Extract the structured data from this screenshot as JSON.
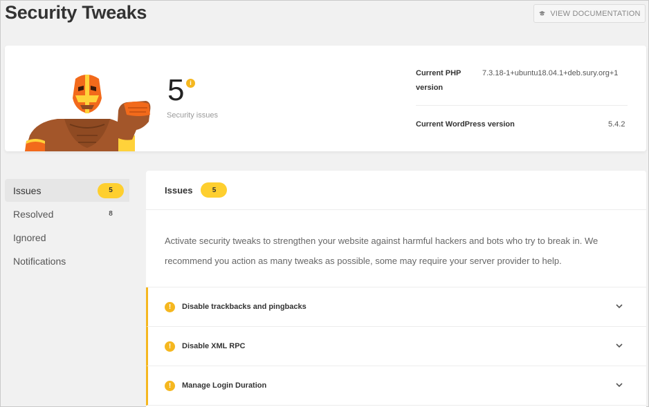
{
  "header": {
    "title": "Security Tweaks",
    "doc_button_label": "VIEW DOCUMENTATION"
  },
  "summary": {
    "issue_count": "5",
    "issue_caption": "Security issues",
    "info_icon": "i",
    "php_label": "Current PHP version",
    "php_value": "7.3.18-1+ubuntu18.04.1+deb.sury.org+1",
    "wp_label": "Current WordPress version",
    "wp_value": "5.4.2"
  },
  "sidebar": {
    "items": [
      {
        "label": "Issues",
        "count": "5"
      },
      {
        "label": "Resolved",
        "count": "8"
      },
      {
        "label": "Ignored",
        "count": ""
      },
      {
        "label": "Notifications",
        "count": ""
      }
    ]
  },
  "main": {
    "title": "Issues",
    "count": "5",
    "intro": "Activate security tweaks to strengthen your website against harmful hackers and bots who try to break in. We recommend you action as many tweaks as possible, some may require your server provider to help.",
    "tweaks": [
      {
        "label": "Disable trackbacks and pingbacks"
      },
      {
        "label": "Disable XML RPC"
      },
      {
        "label": "Manage Login Duration"
      }
    ]
  },
  "icons": {
    "doc": "graduation-cap-icon",
    "warning": "!",
    "chevron": "chevron-down-icon"
  },
  "colors": {
    "accent": "#fecf2f",
    "warning": "#f5b71f",
    "hero_orange": "#f26a1b",
    "hero_skin": "#a3562a"
  }
}
